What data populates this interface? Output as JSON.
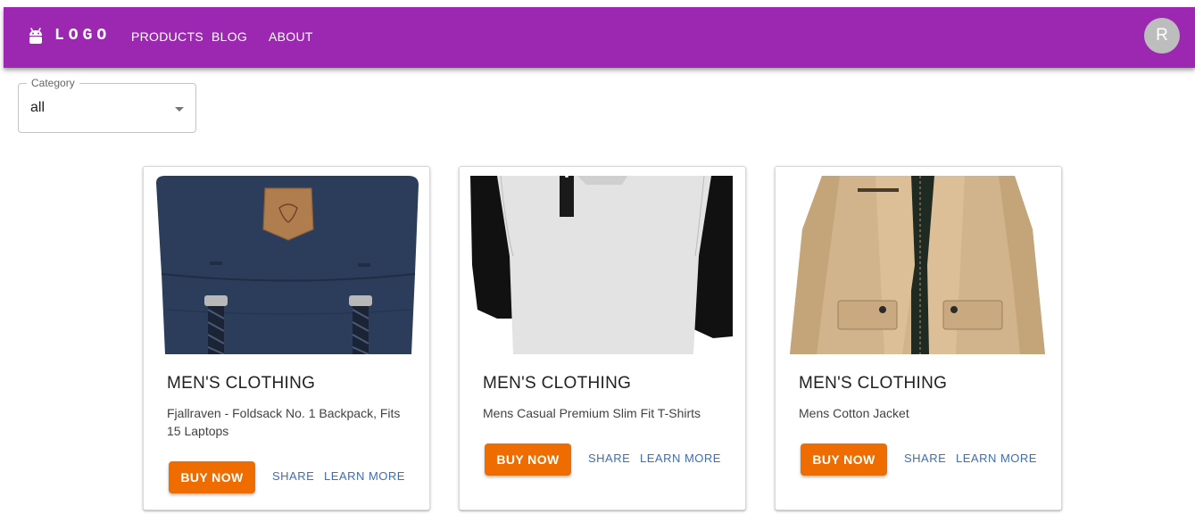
{
  "header": {
    "logo_text": "LOGO",
    "nav": [
      "PRODUCTS",
      "BLOG",
      "ABOUT"
    ],
    "avatar_initial": "R",
    "bar_color": "#9c27b0"
  },
  "filter": {
    "label": "Category",
    "value": "all"
  },
  "products": [
    {
      "category": "MEN'S CLOTHING",
      "title": "Fjallraven - Foldsack No. 1 Backpack, Fits 15 Laptops",
      "image": "backpack",
      "buy_label": "BUY NOW",
      "share_label": "SHARE",
      "learn_label": "LEARN MORE"
    },
    {
      "category": "MEN'S CLOTHING",
      "title": "Mens Casual Premium Slim Fit T-Shirts",
      "image": "t-shirt",
      "buy_label": "BUY NOW",
      "share_label": "SHARE",
      "learn_label": "LEARN MORE"
    },
    {
      "category": "MEN'S CLOTHING",
      "title": "Mens Cotton Jacket",
      "image": "jacket",
      "buy_label": "BUY NOW",
      "share_label": "SHARE",
      "learn_label": "LEARN MORE"
    }
  ],
  "colors": {
    "accent_button": "#ef6c00",
    "link": "#3f6eb5"
  }
}
